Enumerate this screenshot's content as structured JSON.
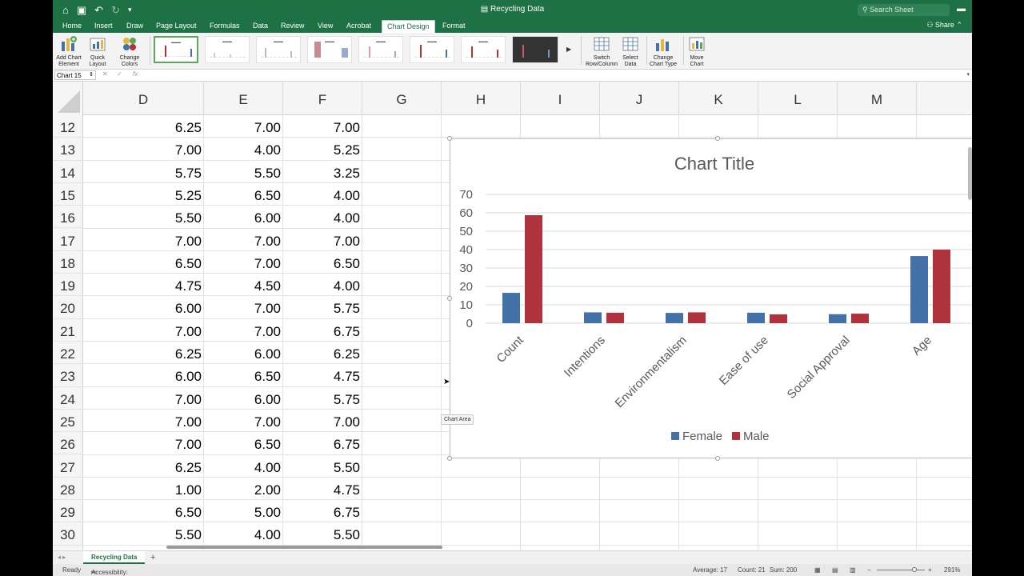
{
  "titlebar": {
    "title": "Recycling Data",
    "search_placeholder": "Search Sheet"
  },
  "tabs": [
    "Home",
    "Insert",
    "Draw",
    "Page Layout",
    "Formulas",
    "Data",
    "Review",
    "View",
    "Acrobat",
    "Chart Design",
    "Format"
  ],
  "active_tab": "Chart Design",
  "share_label": "Share",
  "ribbon": {
    "add_chart_element": [
      "Add Chart",
      "Element"
    ],
    "quick_layout": [
      "Quick",
      "Layout"
    ],
    "change_colors": [
      "Change",
      "Colors"
    ],
    "switch_row_column": [
      "Switch",
      "Row/Column"
    ],
    "select_data": [
      "Select",
      "Data"
    ],
    "change_chart_type": [
      "Change",
      "Chart Type"
    ],
    "move_chart": [
      "Move",
      "Chart"
    ]
  },
  "formula_bar": {
    "name_box": "Chart 15",
    "fx": "fx"
  },
  "columns": [
    "D",
    "E",
    "F",
    "G",
    "H",
    "I",
    "J",
    "K",
    "L",
    "M"
  ],
  "rows": [
    {
      "n": "12",
      "d": "6.25",
      "e": "7.00",
      "f": "7.00"
    },
    {
      "n": "13",
      "d": "7.00",
      "e": "4.00",
      "f": "5.25"
    },
    {
      "n": "14",
      "d": "5.75",
      "e": "5.50",
      "f": "3.25"
    },
    {
      "n": "15",
      "d": "5.25",
      "e": "6.50",
      "f": "4.00"
    },
    {
      "n": "16",
      "d": "5.50",
      "e": "6.00",
      "f": "4.00"
    },
    {
      "n": "17",
      "d": "7.00",
      "e": "7.00",
      "f": "7.00"
    },
    {
      "n": "18",
      "d": "6.50",
      "e": "7.00",
      "f": "6.50"
    },
    {
      "n": "19",
      "d": "4.75",
      "e": "4.50",
      "f": "4.00"
    },
    {
      "n": "20",
      "d": "6.00",
      "e": "7.00",
      "f": "5.75"
    },
    {
      "n": "21",
      "d": "7.00",
      "e": "7.00",
      "f": "6.75"
    },
    {
      "n": "22",
      "d": "6.25",
      "e": "6.00",
      "f": "6.25"
    },
    {
      "n": "23",
      "d": "6.00",
      "e": "6.50",
      "f": "4.75"
    },
    {
      "n": "24",
      "d": "7.00",
      "e": "6.00",
      "f": "5.75"
    },
    {
      "n": "25",
      "d": "7.00",
      "e": "7.00",
      "f": "7.00"
    },
    {
      "n": "26",
      "d": "7.00",
      "e": "6.50",
      "f": "6.75"
    },
    {
      "n": "27",
      "d": "6.25",
      "e": "4.00",
      "f": "5.50"
    },
    {
      "n": "28",
      "d": "1.00",
      "e": "2.00",
      "f": "4.75"
    },
    {
      "n": "29",
      "d": "6.50",
      "e": "5.00",
      "f": "6.75"
    },
    {
      "n": "30",
      "d": "5.50",
      "e": "4.00",
      "f": "5.50"
    }
  ],
  "chart_data": {
    "type": "bar",
    "title": "Chart Title",
    "categories": [
      "Count",
      "Intentions",
      "Environmentalism",
      "Ease of use",
      "Social Approval",
      "Age"
    ],
    "series": [
      {
        "name": "Female",
        "color": "#4472a8",
        "values": [
          16.5,
          5.9,
          5.6,
          5.7,
          4.9,
          36.5
        ]
      },
      {
        "name": "Male",
        "color": "#b0323c",
        "values": [
          58.7,
          5.7,
          5.9,
          4.8,
          5.2,
          40.0
        ]
      }
    ],
    "ylim": [
      0,
      70
    ],
    "yticks": [
      0,
      10,
      20,
      30,
      40,
      50,
      60,
      70
    ],
    "grid": true,
    "legend": "bottom"
  },
  "chart_tooltip": "Chart Area",
  "sheet_tab": "Recycling Data",
  "status": {
    "ready": "Ready",
    "accessibility": "Accessibility: Investigate",
    "average": "Average: 17",
    "count": "Count: 21",
    "sum": "Sum: 200",
    "zoom": "291%"
  }
}
